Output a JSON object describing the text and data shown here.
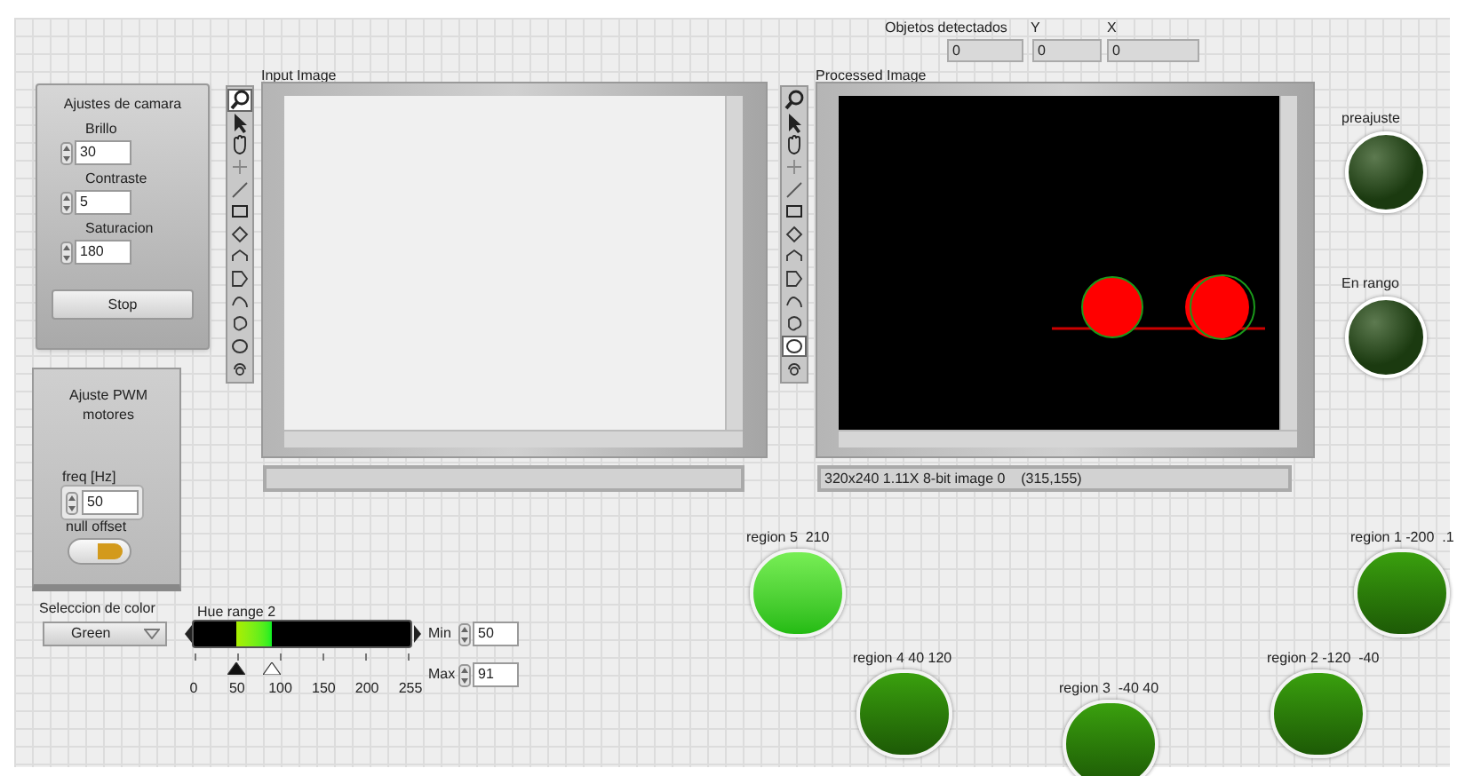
{
  "detection": {
    "label": "Objetos detectados",
    "count": "0",
    "y_label": "Y",
    "y_value": "0",
    "x_label": "X",
    "x_value": "0"
  },
  "camera_settings": {
    "title": "Ajustes de camara",
    "fields": [
      {
        "label": "Brillo",
        "value": "30"
      },
      {
        "label": "Contraste",
        "value": "5"
      },
      {
        "label": "Saturacion",
        "value": "180"
      }
    ],
    "stop_button": "Stop"
  },
  "input_image": {
    "label": "Input Image",
    "tools": [
      {
        "selected": true
      },
      {
        "selected": false
      },
      {
        "selected": false
      },
      {
        "selected": false
      },
      {
        "selected": false
      },
      {
        "selected": false
      },
      {
        "selected": false
      },
      {
        "selected": false
      },
      {
        "selected": false
      },
      {
        "selected": false
      },
      {
        "selected": false
      },
      {
        "selected": false
      },
      {
        "selected": false
      }
    ]
  },
  "processed_image": {
    "label": "Processed Image",
    "tools": [
      {
        "selected": false
      },
      {
        "selected": false
      },
      {
        "selected": false
      },
      {
        "selected": false
      },
      {
        "selected": false
      },
      {
        "selected": false
      },
      {
        "selected": false
      },
      {
        "selected": false
      },
      {
        "selected": false
      },
      {
        "selected": false
      },
      {
        "selected": false
      },
      {
        "selected": true
      },
      {
        "selected": false
      }
    ],
    "status": "320x240 1.11X 8-bit image 0    (315,155)"
  },
  "indicators": [
    {
      "label": "preajuste",
      "on": false
    },
    {
      "label": "En rango",
      "on": false
    }
  ],
  "pwm": {
    "title": "Ajuste PWM motores",
    "freq_label": "freq [Hz]",
    "freq_value": "50",
    "null_offset_label": "null offset",
    "null_offset_on": true
  },
  "color_select": {
    "label": "Seleccion de color",
    "value": "Green"
  },
  "hue_range": {
    "label": "Hue range 2",
    "thumbs": [
      {
        "level": 0.196
      },
      {
        "level": 0.357
      }
    ],
    "scale": [
      "0",
      "50",
      "100",
      "150",
      "200",
      "255"
    ],
    "min_label": "Min",
    "min_value": "50",
    "max_label": "Max",
    "max_value": "91"
  },
  "regions": [
    {
      "label": "region 5  210",
      "on": true
    },
    {
      "label": "region 1 -200  .1",
      "on": false
    },
    {
      "label": "region 4 40 120",
      "on": false
    },
    {
      "label": "region 2 -120  -40",
      "on": false
    },
    {
      "label": "region 3  -40 40",
      "on": false
    }
  ]
}
